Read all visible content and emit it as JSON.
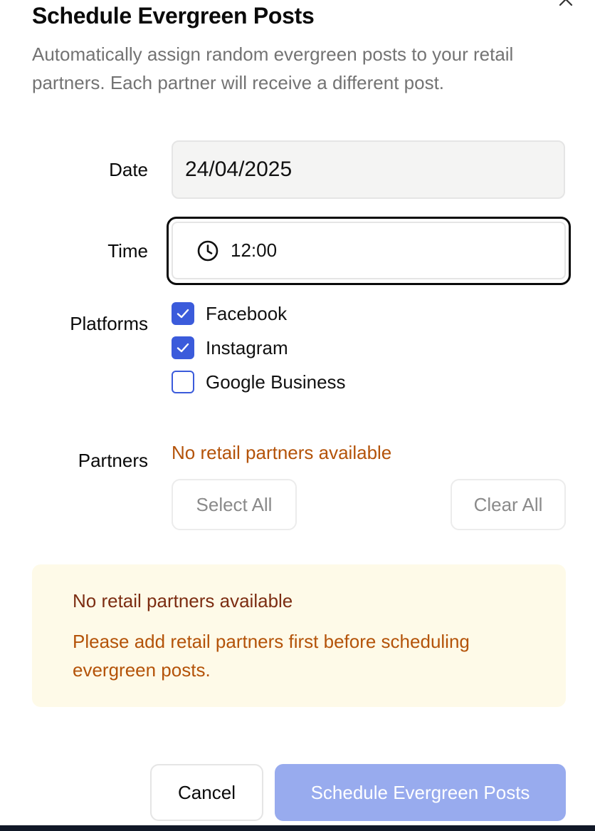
{
  "dialog": {
    "title": "Schedule Evergreen Posts",
    "description": "Automatically assign random evergreen posts to your retail partners. Each partner will receive a different post.",
    "close_icon": "close-icon"
  },
  "form": {
    "date": {
      "label": "Date",
      "value": "24/04/2025"
    },
    "time": {
      "label": "Time",
      "value": "12:00",
      "icon": "clock-icon"
    },
    "platforms": {
      "label": "Platforms",
      "options": [
        {
          "label": "Facebook",
          "checked": true
        },
        {
          "label": "Instagram",
          "checked": true
        },
        {
          "label": "Google Business",
          "checked": false
        }
      ]
    },
    "partners": {
      "label": "Partners",
      "empty_text": "No retail partners available",
      "select_all_label": "Select All",
      "clear_all_label": "Clear All"
    }
  },
  "alert": {
    "title": "No retail partners available",
    "body": "Please add retail partners first before scheduling evergreen posts."
  },
  "footer": {
    "cancel_label": "Cancel",
    "submit_label": "Schedule Evergreen Posts"
  },
  "colors": {
    "accent": "#3b5bdb",
    "submit_disabled": "#98abee",
    "warning_text": "#b45309",
    "warning_title": "#7c2d12",
    "warning_bg": "#fefae8"
  }
}
